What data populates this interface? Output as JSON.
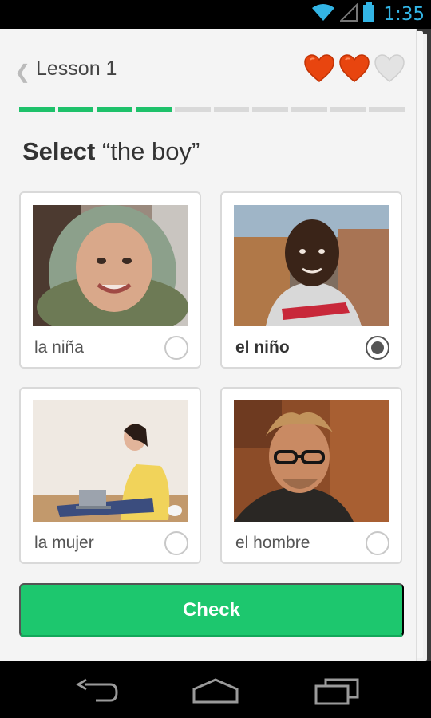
{
  "status_bar": {
    "time": "1:35"
  },
  "header": {
    "lesson_title": "Lesson 1",
    "hearts": [
      "full",
      "full",
      "empty"
    ]
  },
  "progress": {
    "total_segments": 10,
    "completed_segments": 4
  },
  "prompt": {
    "bold": "Select",
    "quoted": "“the boy”"
  },
  "options": [
    {
      "label": "la niña",
      "selected": false
    },
    {
      "label": "el niño",
      "selected": true
    },
    {
      "label": "la mujer",
      "selected": false
    },
    {
      "label": "el hombre",
      "selected": false
    }
  ],
  "check_button": {
    "label": "Check"
  },
  "colors": {
    "accent": "#1dc76e",
    "heart": "#e8450f",
    "status": "#33b5e5"
  }
}
